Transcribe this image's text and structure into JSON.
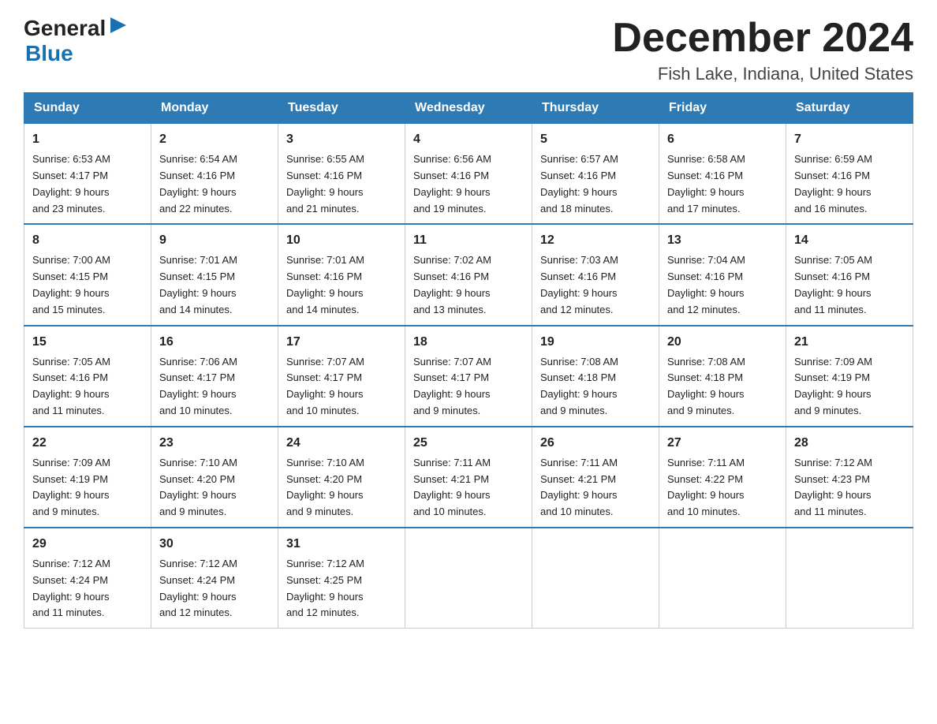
{
  "logo": {
    "general": "General",
    "blue": "Blue",
    "icon_symbol": "▶"
  },
  "header": {
    "month_year": "December 2024",
    "location": "Fish Lake, Indiana, United States"
  },
  "days_of_week": [
    "Sunday",
    "Monday",
    "Tuesday",
    "Wednesday",
    "Thursday",
    "Friday",
    "Saturday"
  ],
  "weeks": [
    [
      {
        "day": "1",
        "sunrise": "6:53 AM",
        "sunset": "4:17 PM",
        "daylight": "9 hours and 23 minutes."
      },
      {
        "day": "2",
        "sunrise": "6:54 AM",
        "sunset": "4:16 PM",
        "daylight": "9 hours and 22 minutes."
      },
      {
        "day": "3",
        "sunrise": "6:55 AM",
        "sunset": "4:16 PM",
        "daylight": "9 hours and 21 minutes."
      },
      {
        "day": "4",
        "sunrise": "6:56 AM",
        "sunset": "4:16 PM",
        "daylight": "9 hours and 19 minutes."
      },
      {
        "day": "5",
        "sunrise": "6:57 AM",
        "sunset": "4:16 PM",
        "daylight": "9 hours and 18 minutes."
      },
      {
        "day": "6",
        "sunrise": "6:58 AM",
        "sunset": "4:16 PM",
        "daylight": "9 hours and 17 minutes."
      },
      {
        "day": "7",
        "sunrise": "6:59 AM",
        "sunset": "4:16 PM",
        "daylight": "9 hours and 16 minutes."
      }
    ],
    [
      {
        "day": "8",
        "sunrise": "7:00 AM",
        "sunset": "4:15 PM",
        "daylight": "9 hours and 15 minutes."
      },
      {
        "day": "9",
        "sunrise": "7:01 AM",
        "sunset": "4:15 PM",
        "daylight": "9 hours and 14 minutes."
      },
      {
        "day": "10",
        "sunrise": "7:01 AM",
        "sunset": "4:16 PM",
        "daylight": "9 hours and 14 minutes."
      },
      {
        "day": "11",
        "sunrise": "7:02 AM",
        "sunset": "4:16 PM",
        "daylight": "9 hours and 13 minutes."
      },
      {
        "day": "12",
        "sunrise": "7:03 AM",
        "sunset": "4:16 PM",
        "daylight": "9 hours and 12 minutes."
      },
      {
        "day": "13",
        "sunrise": "7:04 AM",
        "sunset": "4:16 PM",
        "daylight": "9 hours and 12 minutes."
      },
      {
        "day": "14",
        "sunrise": "7:05 AM",
        "sunset": "4:16 PM",
        "daylight": "9 hours and 11 minutes."
      }
    ],
    [
      {
        "day": "15",
        "sunrise": "7:05 AM",
        "sunset": "4:16 PM",
        "daylight": "9 hours and 11 minutes."
      },
      {
        "day": "16",
        "sunrise": "7:06 AM",
        "sunset": "4:17 PM",
        "daylight": "9 hours and 10 minutes."
      },
      {
        "day": "17",
        "sunrise": "7:07 AM",
        "sunset": "4:17 PM",
        "daylight": "9 hours and 10 minutes."
      },
      {
        "day": "18",
        "sunrise": "7:07 AM",
        "sunset": "4:17 PM",
        "daylight": "9 hours and 9 minutes."
      },
      {
        "day": "19",
        "sunrise": "7:08 AM",
        "sunset": "4:18 PM",
        "daylight": "9 hours and 9 minutes."
      },
      {
        "day": "20",
        "sunrise": "7:08 AM",
        "sunset": "4:18 PM",
        "daylight": "9 hours and 9 minutes."
      },
      {
        "day": "21",
        "sunrise": "7:09 AM",
        "sunset": "4:19 PM",
        "daylight": "9 hours and 9 minutes."
      }
    ],
    [
      {
        "day": "22",
        "sunrise": "7:09 AM",
        "sunset": "4:19 PM",
        "daylight": "9 hours and 9 minutes."
      },
      {
        "day": "23",
        "sunrise": "7:10 AM",
        "sunset": "4:20 PM",
        "daylight": "9 hours and 9 minutes."
      },
      {
        "day": "24",
        "sunrise": "7:10 AM",
        "sunset": "4:20 PM",
        "daylight": "9 hours and 9 minutes."
      },
      {
        "day": "25",
        "sunrise": "7:11 AM",
        "sunset": "4:21 PM",
        "daylight": "9 hours and 10 minutes."
      },
      {
        "day": "26",
        "sunrise": "7:11 AM",
        "sunset": "4:21 PM",
        "daylight": "9 hours and 10 minutes."
      },
      {
        "day": "27",
        "sunrise": "7:11 AM",
        "sunset": "4:22 PM",
        "daylight": "9 hours and 10 minutes."
      },
      {
        "day": "28",
        "sunrise": "7:12 AM",
        "sunset": "4:23 PM",
        "daylight": "9 hours and 11 minutes."
      }
    ],
    [
      {
        "day": "29",
        "sunrise": "7:12 AM",
        "sunset": "4:24 PM",
        "daylight": "9 hours and 11 minutes."
      },
      {
        "day": "30",
        "sunrise": "7:12 AM",
        "sunset": "4:24 PM",
        "daylight": "9 hours and 12 minutes."
      },
      {
        "day": "31",
        "sunrise": "7:12 AM",
        "sunset": "4:25 PM",
        "daylight": "9 hours and 12 minutes."
      },
      null,
      null,
      null,
      null
    ]
  ],
  "labels": {
    "sunrise": "Sunrise:",
    "sunset": "Sunset:",
    "daylight": "Daylight:"
  }
}
